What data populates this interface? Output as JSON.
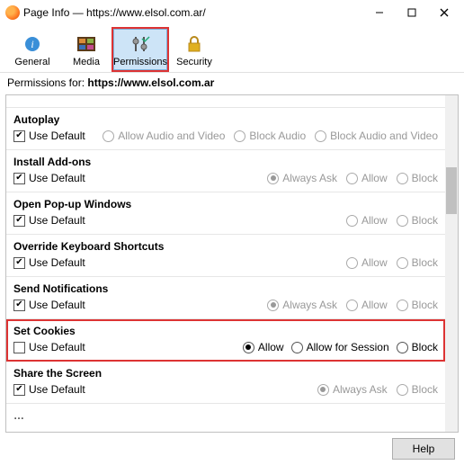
{
  "window": {
    "title": "Page Info — https://www.elsol.com.ar/"
  },
  "tabs": {
    "general": "General",
    "media": "Media",
    "permissions": "Permissions",
    "security": "Security"
  },
  "permfor": {
    "label": "Permissions for:",
    "url": "https://www.elsol.com.ar"
  },
  "useDefaultLabel": "Use Default",
  "options": {
    "allow": "Allow",
    "block": "Block",
    "alwaysAsk": "Always Ask",
    "allowForSession": "Allow for Session",
    "allowAudioVideo": "Allow Audio and Video",
    "blockAudio": "Block Audio",
    "blockAudioVideo": "Block Audio and Video"
  },
  "permissions": {
    "autoplay": {
      "title": "Autoplay",
      "useDefault": true
    },
    "installAddons": {
      "title": "Install Add-ons",
      "useDefault": true
    },
    "popups": {
      "title": "Open Pop-up Windows",
      "useDefault": true
    },
    "shortcuts": {
      "title": "Override Keyboard Shortcuts",
      "useDefault": true
    },
    "notifications": {
      "title": "Send Notifications",
      "useDefault": true
    },
    "cookies": {
      "title": "Set Cookies",
      "useDefault": false,
      "selected": "allow"
    },
    "screen": {
      "title": "Share the Screen",
      "useDefault": true
    }
  },
  "footer": {
    "help": "Help"
  }
}
